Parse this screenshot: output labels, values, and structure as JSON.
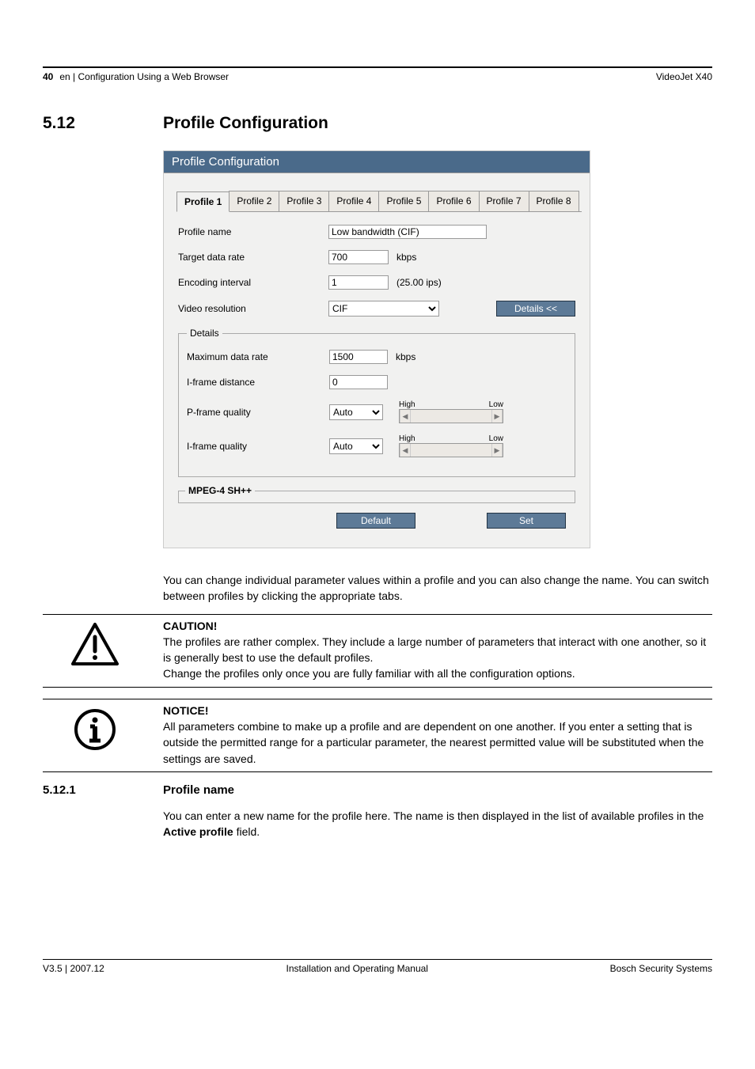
{
  "header": {
    "page_number": "40",
    "breadcrumb": "en | Configuration Using a Web Browser",
    "product": "VideoJet X40"
  },
  "section": {
    "number": "5.12",
    "title": "Profile Configuration"
  },
  "panel": {
    "title": "Profile Configuration",
    "tabs": [
      "Profile 1",
      "Profile 2",
      "Profile 3",
      "Profile 4",
      "Profile 5",
      "Profile 6",
      "Profile 7",
      "Profile 8"
    ],
    "active_tab": 0,
    "fields": {
      "profile_name_label": "Profile name",
      "profile_name_value": "Low bandwidth (CIF)",
      "target_rate_label": "Target data rate",
      "target_rate_value": "700",
      "target_rate_unit": "kbps",
      "encoding_interval_label": "Encoding interval",
      "encoding_interval_value": "1",
      "encoding_interval_note": "(25.00 ips)",
      "video_res_label": "Video resolution",
      "video_res_value": "CIF",
      "details_button": "Details <<"
    },
    "details": {
      "legend": "Details",
      "max_rate_label": "Maximum data rate",
      "max_rate_value": "1500",
      "max_rate_unit": "kbps",
      "iframe_dist_label": "I-frame distance",
      "iframe_dist_value": "0",
      "pframe_q_label": "P-frame quality",
      "pframe_q_value": "Auto",
      "iframe_q_label": "I-frame quality",
      "iframe_q_value": "Auto",
      "slider_high": "High",
      "slider_low": "Low"
    },
    "mpeg_legend": "MPEG-4 SH++",
    "default_btn": "Default",
    "set_btn": "Set"
  },
  "para1": "You can change individual parameter values within a profile and you can also change the name. You can switch between profiles by clicking the appropriate tabs.",
  "caution": {
    "head": "CAUTION!",
    "line1": "The profiles are rather complex. They include a large number of parameters that interact with one another, so it is generally best to use the default profiles.",
    "line2": "Change the profiles only once you are fully familiar with all the configuration options."
  },
  "notice": {
    "head": "NOTICE!",
    "text": "All parameters combine to make up a profile and are dependent on one another. If you enter a setting that is outside the permitted range for a particular parameter, the nearest permitted value will be substituted when the settings are saved."
  },
  "subsection": {
    "number": "5.12.1",
    "title": "Profile name",
    "text_a": "You can enter a new name for the profile here. The name is then displayed in the list of available profiles in the ",
    "text_b": "Active profile",
    "text_c": " field."
  },
  "footer": {
    "left": "V3.5 | 2007.12",
    "center": "Installation and Operating Manual",
    "right": "Bosch Security Systems"
  }
}
